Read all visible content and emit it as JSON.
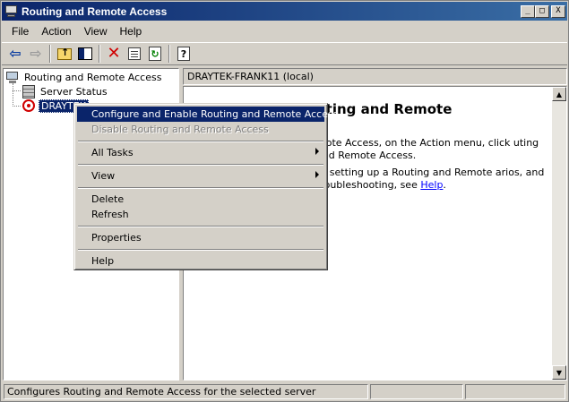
{
  "window": {
    "title": "Routing and Remote Access",
    "controls": {
      "minimize": "_",
      "maximize": "□",
      "close": "X"
    }
  },
  "menubar": {
    "items": [
      "File",
      "Action",
      "View",
      "Help"
    ]
  },
  "toolbar": {
    "icons": [
      "back-arrow-icon",
      "forward-arrow-icon",
      "up-one-level-icon",
      "show-hide-tree-icon",
      "delete-icon",
      "properties-icon",
      "refresh-icon",
      "help-icon"
    ]
  },
  "tree": {
    "root": "Routing and Remote Access",
    "server_status": "Server Status",
    "server": "DRAYTEK-FRANK11 (local)",
    "server_visible": "DRAYTEK",
    "server_selected_tail": "-FRANK11 (local)"
  },
  "right_pane": {
    "header": "DRAYTEK-FRANK11 (local)",
    "heading": "Configure the Routing and Remote",
    "heading_visible": "uting and Remote",
    "p1_visible": "mote Access, on the Action menu, click uting and Remote Access.",
    "p2_visible": "ut setting up a Routing and Remote arios, and troubleshooting, see ",
    "p2_link": "Help",
    "p2_end": "."
  },
  "context_menu": {
    "items": [
      {
        "label": "Configure and Enable Routing and Remote Access",
        "state": "highlighted"
      },
      {
        "label": "Disable Routing and Remote Access",
        "state": "disabled"
      },
      {
        "label": "All Tasks",
        "state": "submenu"
      },
      {
        "label": "View",
        "state": "submenu"
      },
      {
        "label": "Delete",
        "state": "normal"
      },
      {
        "label": "Refresh",
        "state": "normal"
      },
      {
        "label": "Properties",
        "state": "normal"
      },
      {
        "label": "Help",
        "state": "normal"
      }
    ]
  },
  "statusbar": {
    "text": "Configures Routing and Remote Access for the selected server",
    "panel2": "",
    "panel3": ""
  },
  "colors": {
    "titlebar_start": "#0a246a",
    "titlebar_end": "#3a6ea5",
    "highlight": "#0a246a",
    "face": "#d4d0c8",
    "link": "#0000ff"
  }
}
